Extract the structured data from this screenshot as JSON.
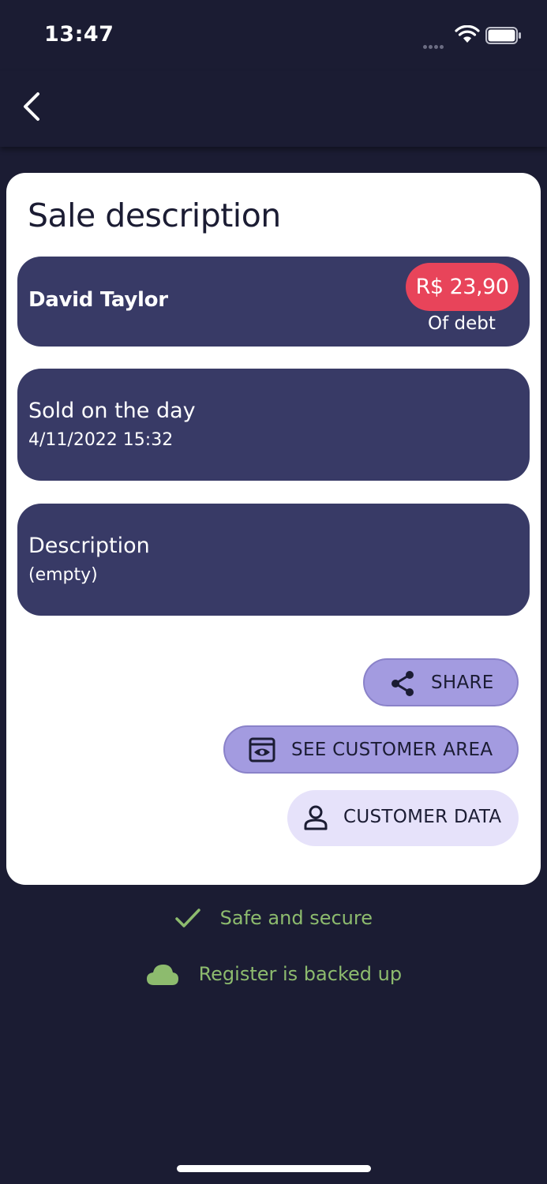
{
  "status_bar": {
    "time": "13:47"
  },
  "page": {
    "title": "Sale description"
  },
  "customer": {
    "name": "David Taylor",
    "debt_amount": "R$ 23,90",
    "debt_label": "Of debt"
  },
  "sale": {
    "sold_label": "Sold on the day",
    "sold_date": "4/11/2022 15:32"
  },
  "description": {
    "label": "Description",
    "value": "(empty)"
  },
  "actions": {
    "share": "SHARE",
    "see_customer_area": "SEE CUSTOMER AREA",
    "customer_data": "CUSTOMER DATA"
  },
  "footer": {
    "safe_text": "Safe and secure",
    "backup_text": "Register is backed up"
  },
  "colors": {
    "background": "#1b1c33",
    "card": "#383a66",
    "debt_badge": "#e8445a",
    "primary_pill": "#a39be0",
    "secondary_pill": "#e6e2fa",
    "success_green": "#8dbb6e"
  },
  "icons": {
    "back": "chevron-left-icon",
    "share": "share-icon",
    "customer_area": "eye-icon",
    "customer_data": "person-icon",
    "safe": "checkmark-icon",
    "backup": "cloud-icon"
  }
}
